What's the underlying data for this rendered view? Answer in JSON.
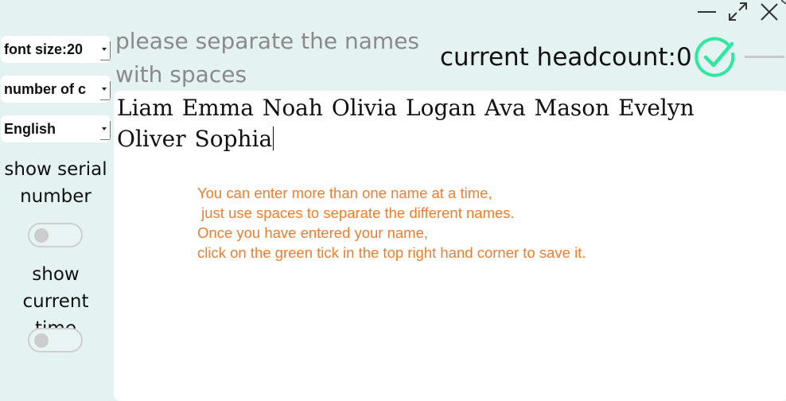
{
  "window": {
    "controls": {
      "minimize_icon": "minimize-icon",
      "maximize_icon": "expand-icon",
      "close_icon": "close-icon"
    }
  },
  "sidebar": {
    "font_size_select": {
      "value": "font size:20"
    },
    "number_select": {
      "value": "number of c"
    },
    "language_select": {
      "value": "English"
    },
    "show_serial_label": "show serial number",
    "show_serial_on": false,
    "show_time_label": "show current time",
    "show_time_on": false
  },
  "header": {
    "hint": "please separate the names with spaces",
    "headcount_label": "current headcount:0",
    "save_icon": "check-circle-icon",
    "accent_color": "#2ee8a2"
  },
  "editor": {
    "names": "Liam Emma Noah Olivia Logan Ava Mason Evelyn Oliver Sophia",
    "instructions": [
      "You can enter more than one name at a time,",
      " just use spaces to separate the different names.",
      "Once you have entered your name,",
      "click on the green tick in the top right hand corner to save it."
    ],
    "instruction_color": "#f07d2c"
  }
}
